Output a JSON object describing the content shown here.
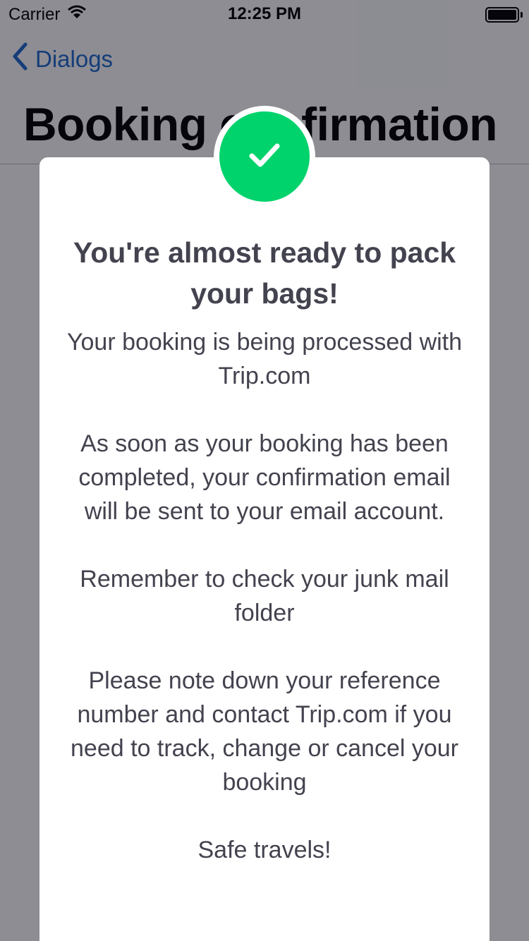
{
  "status_bar": {
    "carrier": "Carrier",
    "time": "12:25 PM"
  },
  "nav": {
    "back_label": "Dialogs",
    "large_title": "Booking confirmation",
    "accent_color": "#1e66c9"
  },
  "dialog": {
    "icon": "checkmark-icon",
    "icon_color": "#00d36c",
    "title": "You're almost ready to pack your bags!",
    "paragraphs": [
      "Your booking is being processed with Trip.com",
      "As soon as your booking has been completed, your confirmation email will be sent to your email account.",
      "Remember to check your junk mail folder",
      "Please note down your reference number and contact Trip.com if you need to track, change or cancel your booking",
      "Safe travels!"
    ]
  }
}
